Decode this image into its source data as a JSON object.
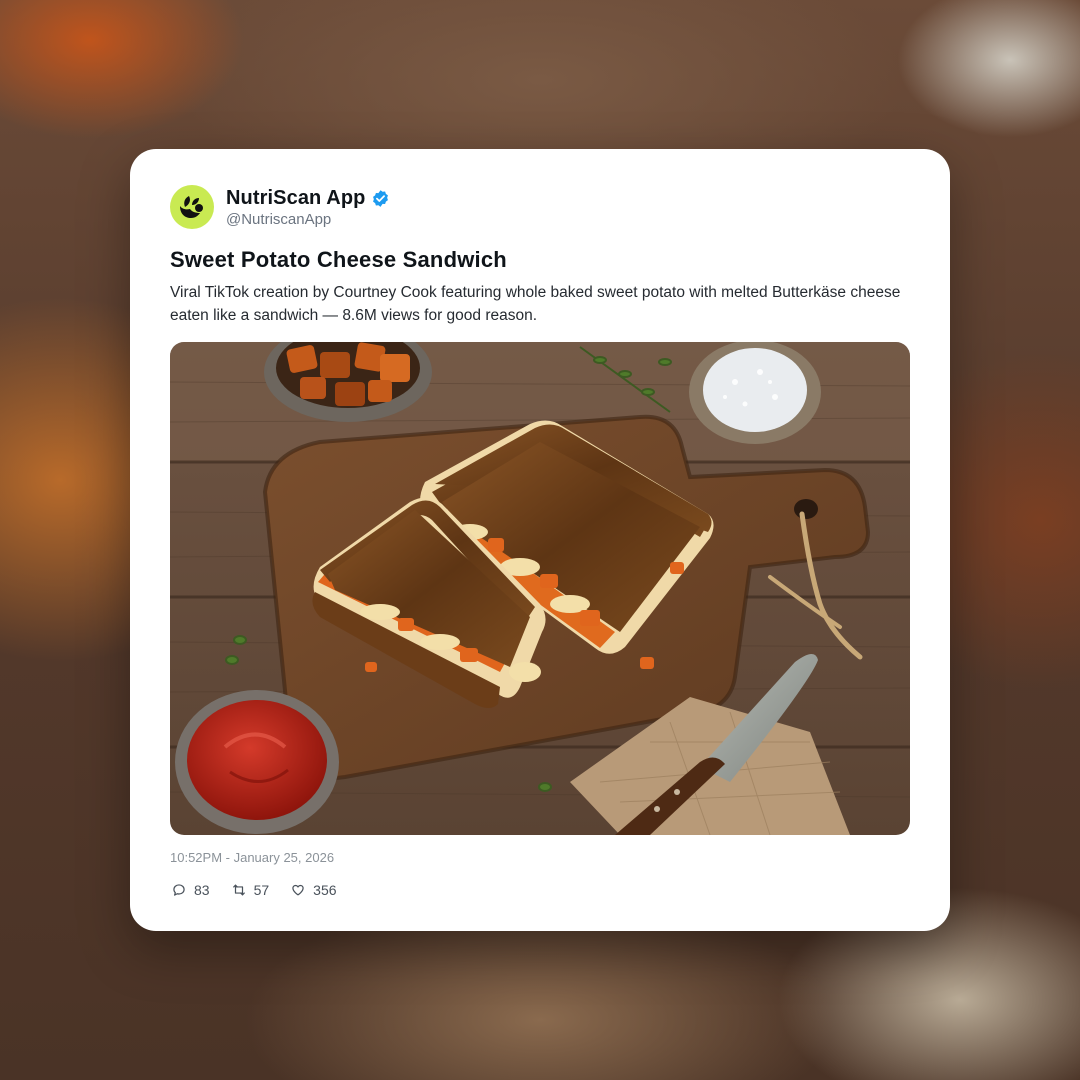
{
  "post": {
    "display_name": "NutriScan App",
    "handle": "@NutriscanApp",
    "verified": true,
    "avatar_icon": "nutriscan-logo-icon",
    "avatar_color": "#c9ea52",
    "title": "Sweet Potato Cheese Sandwich",
    "description": "Viral TikTok creation by Courtney Cook featuring whole baked sweet potato with melted Butterkäse cheese eaten like a sandwich — 8.6M views for good reason.",
    "timestamp": "10:52PM - January 25, 2026",
    "image_icon": "grilled-sandwich-photo",
    "stats": {
      "replies": "83",
      "reposts": "57",
      "likes": "356"
    }
  },
  "colors": {
    "accent_verified": "#1d9bf0",
    "text_primary": "#0f1419",
    "text_muted": "#6b7480"
  }
}
